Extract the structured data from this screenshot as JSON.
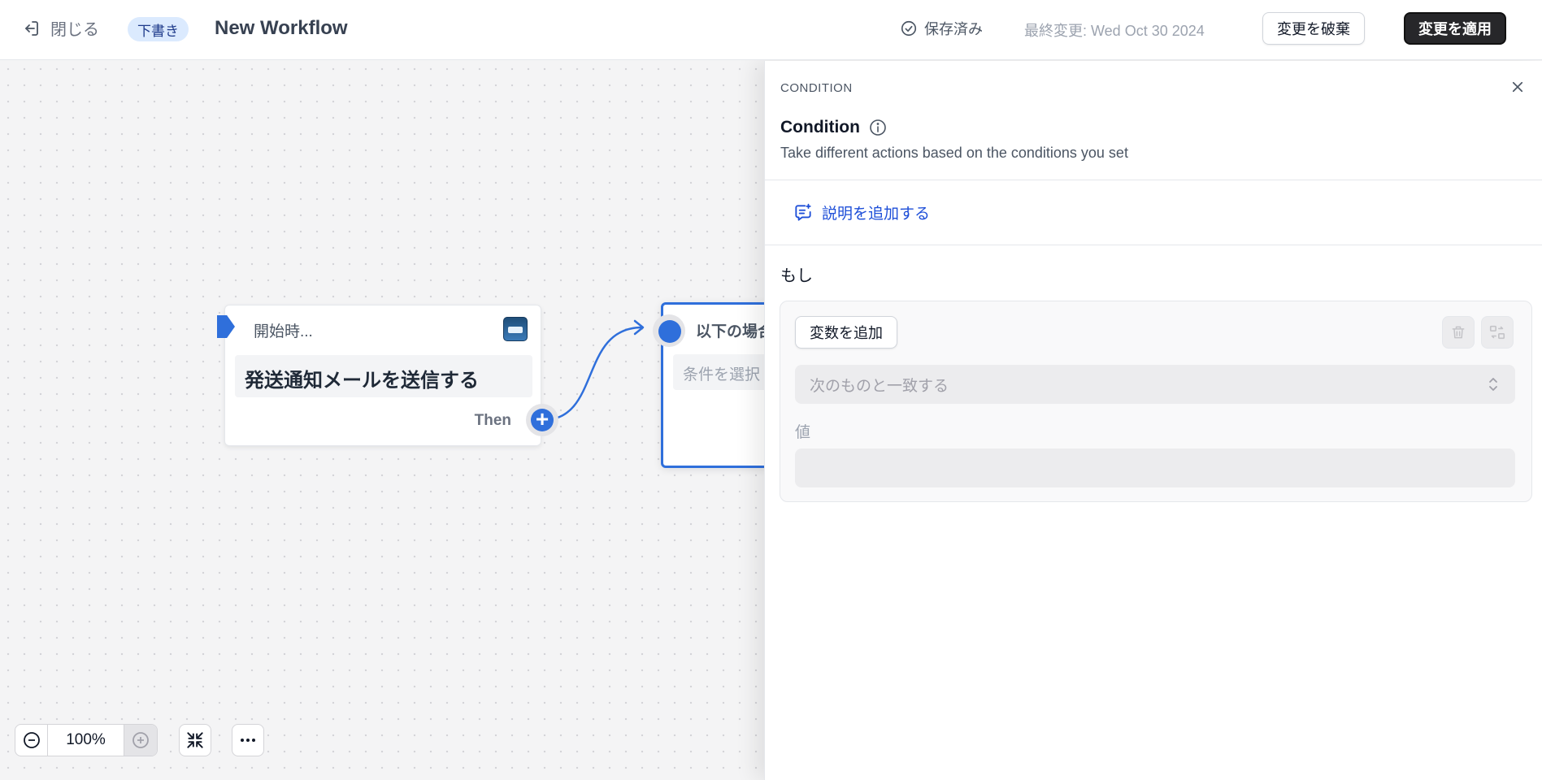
{
  "topbar": {
    "close_label": "閉じる",
    "draft_badge": "下書き",
    "workflow_title": "New Workflow",
    "saved_label": "保存済み",
    "last_modified": "最終変更: Wed Oct 30 2024",
    "discard_label": "変更を破棄",
    "apply_label": "変更を適用"
  },
  "canvas": {
    "start_node": {
      "label": "開始時...",
      "action": "発送通知メールを送信する",
      "then_label": "Then"
    },
    "condition_node": {
      "label": "以下の場合",
      "select_placeholder": "条件を選択"
    },
    "zoom": {
      "value": "100%"
    }
  },
  "panel": {
    "eyebrow": "CONDITION",
    "title": "Condition",
    "description": "Take different actions based on the conditions you set",
    "add_description": "説明を追加する",
    "if_label": "もし",
    "add_variable": "変数を追加",
    "match_placeholder": "次のものと一致する",
    "value_label": "値"
  },
  "colors": {
    "accent": "#2f6fdb",
    "link": "#1d4ed8",
    "apply_bg": "#27272a",
    "draft_bg": "#dbeafe"
  }
}
